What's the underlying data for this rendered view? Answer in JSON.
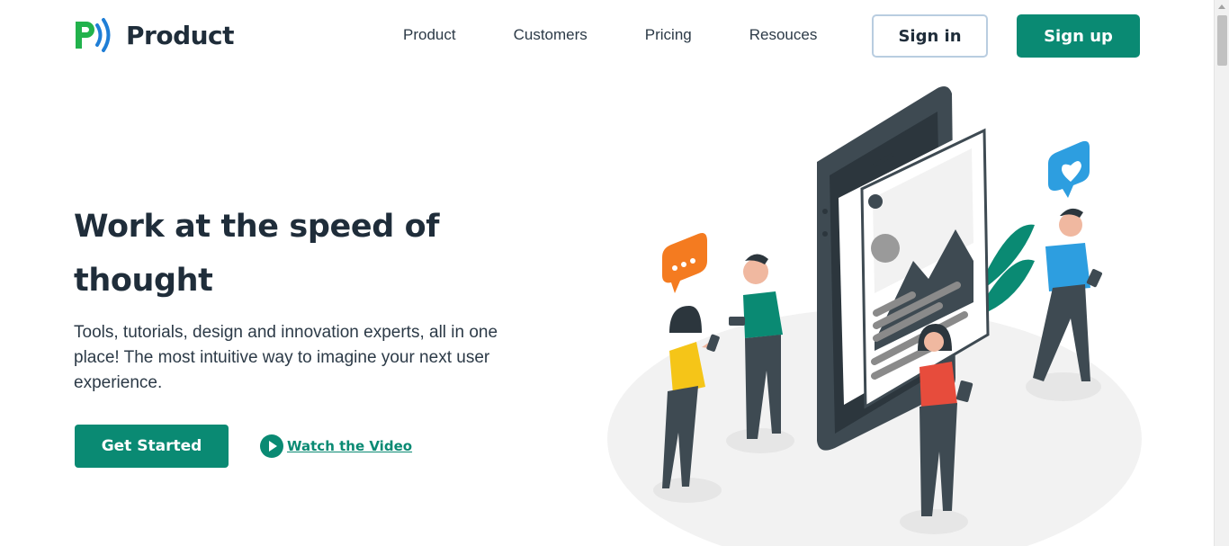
{
  "brand": {
    "name": "Product",
    "accent": "#0a8a73",
    "logo_green": "#22b24c",
    "logo_blue": "#1f7ed6"
  },
  "nav": {
    "items": [
      "Product",
      "Customers",
      "Pricing",
      "Resouces"
    ]
  },
  "auth": {
    "signin_label": "Sign in",
    "signup_label": "Sign up"
  },
  "hero": {
    "title": "Work at the speed of thought",
    "subtitle": "Tools, tutorials, design and innovation experts, all in one place! The most intuitive way to imagine your next user experience.",
    "cta_label": "Get Started",
    "video_label": "Watch the Video"
  },
  "illustration": {
    "icon": "people-using-phones-illustration"
  }
}
